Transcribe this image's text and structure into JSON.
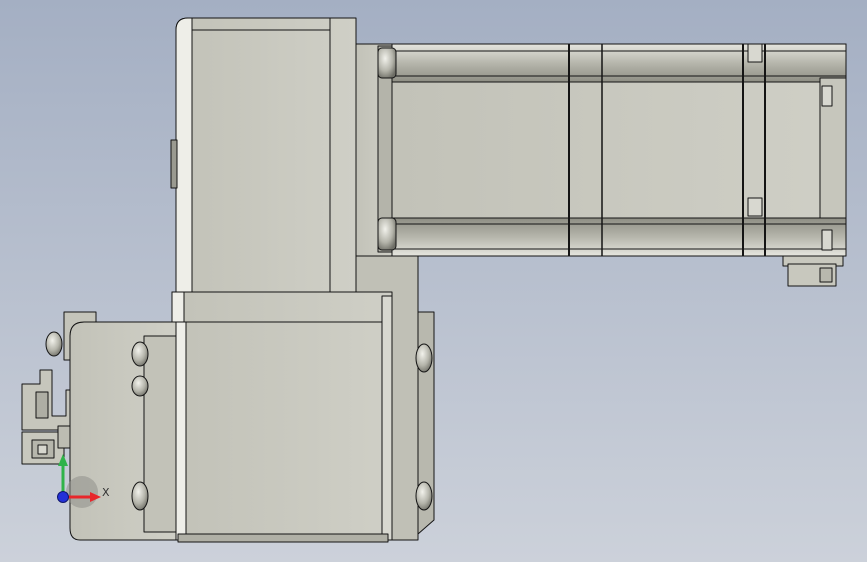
{
  "viewport": {
    "background_top": "#a4afc3",
    "background_bottom": "#ccd1da"
  },
  "model": {
    "body_color": "#c8c8be",
    "shade_color": "#a9a99f",
    "highlight_color": "#eeeee8",
    "edge_color": "#141414"
  },
  "triad": {
    "x_label": "X",
    "x_color": "#e8262b",
    "y_color": "#2fb34a",
    "z_color": "#2330d8"
  }
}
